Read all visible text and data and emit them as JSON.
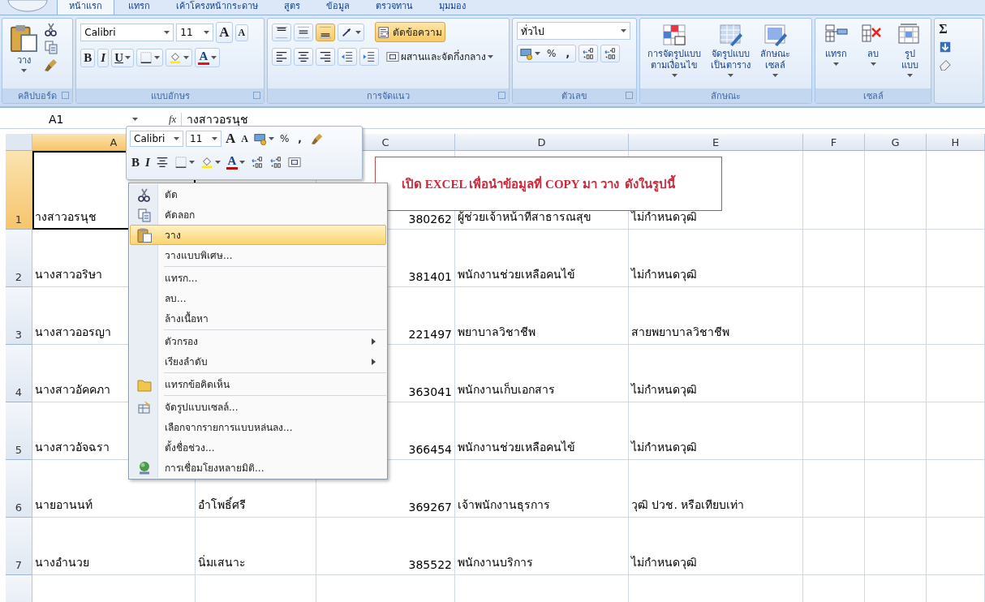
{
  "ribbon_tabs": [
    {
      "label": "หน้าแรก",
      "selected": true
    },
    {
      "label": "แทรก",
      "selected": false
    },
    {
      "label": "เค้าโครงหน้ากระดาษ",
      "selected": false
    },
    {
      "label": "สูตร",
      "selected": false
    },
    {
      "label": "ข้อมูล",
      "selected": false
    },
    {
      "label": "ตรวจทาน",
      "selected": false
    },
    {
      "label": "มุมมอง",
      "selected": false
    }
  ],
  "clipboard": {
    "paste": "วาง",
    "label": "คลิปบอร์ด"
  },
  "font": {
    "name": "Calibri",
    "size": "11",
    "grow": "A",
    "shrink": "A",
    "bold": "B",
    "italic": "I",
    "underline": "U",
    "font_color": "A",
    "label": "แบบอักษร"
  },
  "alignment": {
    "vertical": [
      {
        "selected": false
      },
      {
        "selected": false
      },
      {
        "selected": true
      }
    ],
    "wrap_text": {
      "label": "ตัดข้อความ",
      "on": true
    },
    "merge": "ผสานและจัดกึ่งกลาง",
    "label": "การจัดแนว"
  },
  "number": {
    "format": "ทั่วไป",
    "percent": "%",
    "comma": ",",
    "label": "ตัวเลข"
  },
  "styles": {
    "buttons": [
      "การจัดรูปแบบ\nตามเงื่อนไข",
      "จัดรูปแบบ\nเป็นตาราง",
      "ลักษณะ\nเซลล์"
    ],
    "label": "ลักษณะ"
  },
  "cells": {
    "buttons": [
      "แทรก",
      "ลบ",
      "รูปแบบ"
    ],
    "label": "เซลล์"
  },
  "editing": {
    "sum": "Σ"
  },
  "formula_bar": {
    "name_box": "A1",
    "fx": "fx",
    "content": "างสาวอรนุช"
  },
  "sheet": {
    "columns": [
      {
        "label": "A",
        "selected": true
      },
      null,
      {
        "label": "C",
        "selected": false
      },
      {
        "label": "D",
        "selected": false
      },
      {
        "label": "E",
        "selected": false
      },
      {
        "label": "F",
        "selected": false
      },
      {
        "label": "G",
        "selected": false
      },
      {
        "label": "H",
        "selected": false
      }
    ],
    "rows": [
      {
        "number": "1",
        "selected": true,
        "a": "างสาวอรนุช",
        "c": "380262",
        "d": "ผู้ช่วยเจ้าหน้าที่สาธารณสุข",
        "e": "ไม่กำหนดวุฒิ"
      },
      {
        "number": "2",
        "selected": false,
        "a": "นางสาวอริษา",
        "c": "381401",
        "d": "พนักงานช่วยเหลือคนไข้",
        "e": "ไม่กำหนดวุฒิ"
      },
      {
        "number": "3",
        "selected": false,
        "a": "นางสาวออรญา",
        "c": "221497",
        "d": "พยาบาลวิชาชีพ",
        "e": "สายพยาบาลวิชาชีพ"
      },
      {
        "number": "4",
        "selected": false,
        "a": "นางสาวอัคคภา",
        "c": "363041",
        "d": "พนักงานเก็บเอกสาร",
        "e": "ไม่กำหนดวุฒิ"
      },
      {
        "number": "5",
        "selected": false,
        "a": "นางสาวอัจฉรา",
        "c": "366454",
        "d": "พนักงานช่วยเหลือคนไข้",
        "e": "ไม่กำหนดวุฒิ"
      },
      {
        "number": "6",
        "selected": false,
        "a": "นายอานนท์",
        "b": "อำโพธิ์ศรี",
        "c": "369267",
        "d": "เจ้าพนักงานธุรการ",
        "e": "วุฒิ ปวช. หรือเทียบเท่า"
      },
      {
        "number": "7",
        "selected": false,
        "a": "นางอำนวย",
        "b": "นิ่มเสนาะ",
        "c": "385522",
        "d": "พนักงานบริการ",
        "e": "ไม่กำหนดวุฒิ"
      }
    ]
  },
  "mini_toolbar": {
    "font": "Calibri",
    "size": "11",
    "grow": "A",
    "shrink": "A",
    "percent": "%",
    "comma": ",",
    "bold": "B",
    "italic": "I",
    "font_color": "A"
  },
  "context_menu": {
    "groups": [
      [
        {
          "label": "ตัด",
          "kind": "cut",
          "selected": false,
          "submenu": false
        },
        {
          "label": "คัดลอก",
          "kind": "copy",
          "selected": false,
          "submenu": false
        },
        {
          "label": "วาง",
          "kind": "paste",
          "selected": true,
          "submenu": false
        },
        {
          "label": "วางแบบพิเศษ...",
          "kind": "plain",
          "selected": false,
          "submenu": false
        }
      ],
      [
        {
          "label": "แทรก...",
          "kind": "plain",
          "selected": false,
          "submenu": false
        },
        {
          "label": "ลบ...",
          "kind": "plain",
          "selected": false,
          "submenu": false
        },
        {
          "label": "ล้างเนื้อหา",
          "kind": "plain",
          "selected": false,
          "submenu": false
        }
      ],
      [
        {
          "label": "ตัวกรอง",
          "kind": "plain",
          "selected": false,
          "submenu": true
        },
        {
          "label": "เรียงลำดับ",
          "kind": "plain",
          "selected": false,
          "submenu": true
        }
      ],
      [
        {
          "label": "แทรกข้อคิดเห็น",
          "kind": "comment",
          "selected": false,
          "submenu": false
        }
      ],
      [
        {
          "label": "จัดรูปแบบเซลล์...",
          "kind": "format",
          "selected": false,
          "submenu": false
        },
        {
          "label": "เลือกจากรายการแบบหล่นลง...",
          "kind": "plain",
          "selected": false,
          "submenu": false
        },
        {
          "label": "ตั้งชื่อช่วง...",
          "kind": "plain",
          "selected": false,
          "submenu": false
        },
        {
          "label": "การเชื่อมโยงหลายมิติ...",
          "kind": "link",
          "selected": false,
          "submenu": false
        }
      ]
    ]
  },
  "note": {
    "text": "เปิด EXCEL เพื่อนำข้อมูลที่ COPY มา วาง  ดังในรูปนี้"
  }
}
